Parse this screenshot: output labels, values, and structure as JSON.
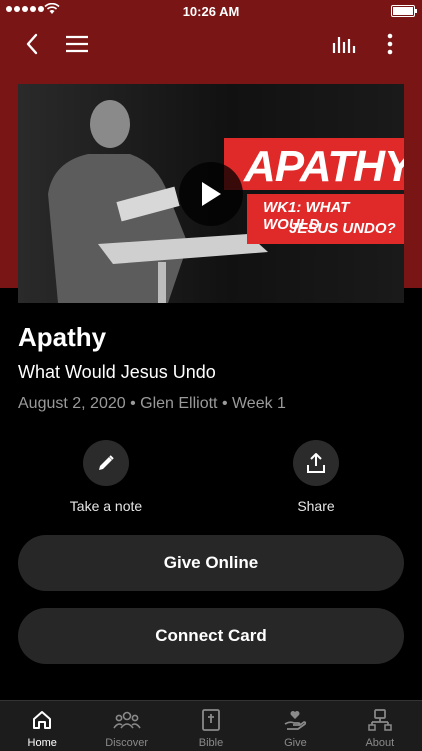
{
  "status_bar": {
    "time": "10:26 AM"
  },
  "colors": {
    "header_bg": "#7a1515",
    "banner_red": "#e02a2a",
    "button_bg": "#272727"
  },
  "nav": {
    "icons": [
      "back-icon",
      "menu-icon",
      "audio-bars-icon",
      "more-icon"
    ]
  },
  "video": {
    "banner_title": "APATHY",
    "banner_line1": "WK1: WHAT WOULD",
    "banner_line2": "JESUS UNDO?"
  },
  "sermon": {
    "title": "Apathy",
    "subtitle": "What Would Jesus Undo",
    "meta": "August 2, 2020 • Glen Elliott • Week 1"
  },
  "actions": {
    "note_label": "Take a note",
    "share_label": "Share"
  },
  "buttons": {
    "give_online": "Give Online",
    "connect_card": "Connect Card"
  },
  "tabs": [
    {
      "label": "Home",
      "icon": "home-icon",
      "active": true
    },
    {
      "label": "Discover",
      "icon": "people-icon",
      "active": false
    },
    {
      "label": "Bible",
      "icon": "bible-icon",
      "active": false
    },
    {
      "label": "Give",
      "icon": "give-hand-icon",
      "active": false
    },
    {
      "label": "About",
      "icon": "about-org-icon",
      "active": false
    }
  ]
}
